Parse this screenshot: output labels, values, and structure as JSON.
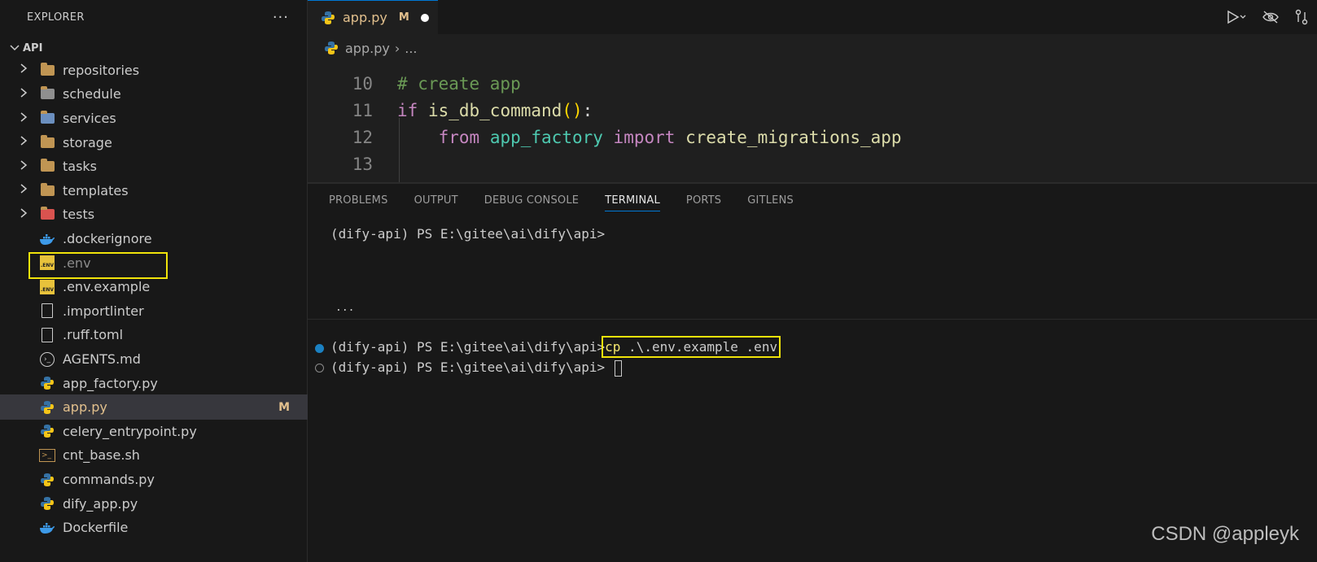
{
  "sidebar": {
    "title": "EXPLORER",
    "more": "···",
    "root": "API",
    "items": [
      {
        "label": "repositories",
        "type": "folder",
        "chev": "›"
      },
      {
        "label": "schedule",
        "type": "folder",
        "chev": "›"
      },
      {
        "label": "services",
        "type": "folder",
        "chev": "›"
      },
      {
        "label": "storage",
        "type": "folder",
        "chev": "›"
      },
      {
        "label": "tasks",
        "type": "folder",
        "chev": "›"
      },
      {
        "label": "templates",
        "type": "folder",
        "chev": "›"
      },
      {
        "label": "tests",
        "type": "folder",
        "chev": "›"
      },
      {
        "label": ".dockerignore",
        "type": "docker"
      },
      {
        "label": ".env",
        "type": "env"
      },
      {
        "label": ".env.example",
        "type": "env"
      },
      {
        "label": ".importlinter",
        "type": "file"
      },
      {
        "label": ".ruff.toml",
        "type": "file"
      },
      {
        "label": "AGENTS.md",
        "type": "md"
      },
      {
        "label": "app_factory.py",
        "type": "python"
      },
      {
        "label": "app.py",
        "type": "python",
        "badge": "M"
      },
      {
        "label": "celery_entrypoint.py",
        "type": "python"
      },
      {
        "label": "cnt_base.sh",
        "type": "shell"
      },
      {
        "label": "commands.py",
        "type": "python"
      },
      {
        "label": "dify_app.py",
        "type": "python"
      },
      {
        "label": "Dockerfile",
        "type": "docker"
      }
    ]
  },
  "editor": {
    "tab": {
      "name": "app.py",
      "modified": "M"
    },
    "breadcrumb": {
      "file": "app.py",
      "sep": "›",
      "rest": "..."
    },
    "lines": [
      {
        "n": "10"
      },
      {
        "n": "11"
      },
      {
        "n": "12"
      },
      {
        "n": "13"
      }
    ],
    "code": {
      "comment": "# create app",
      "kw_if": "if",
      "fn_is_db": "is_db_command",
      "parens": "()",
      "colon": ":",
      "kw_from": "from",
      "mod": "app_factory",
      "kw_import": "import",
      "fn_create": "create_migrations_app"
    }
  },
  "panel": {
    "tabs": [
      "PROBLEMS",
      "OUTPUT",
      "DEBUG CONSOLE",
      "TERMINAL",
      "PORTS",
      "GITLENS"
    ],
    "active_tab": "TERMINAL",
    "terminal": {
      "prompt": "(dify-api) PS E:\\gitee\\ai\\dify\\api>",
      "ellipsis": "...",
      "cmd_kw": "cp",
      "cmd_args": " .\\.env.example .env"
    }
  },
  "watermark": "CSDN @appleyk",
  "colors": {
    "accent": "#0078d4",
    "highlight_box": "#f0e30a",
    "modified": "#e2c08d"
  }
}
